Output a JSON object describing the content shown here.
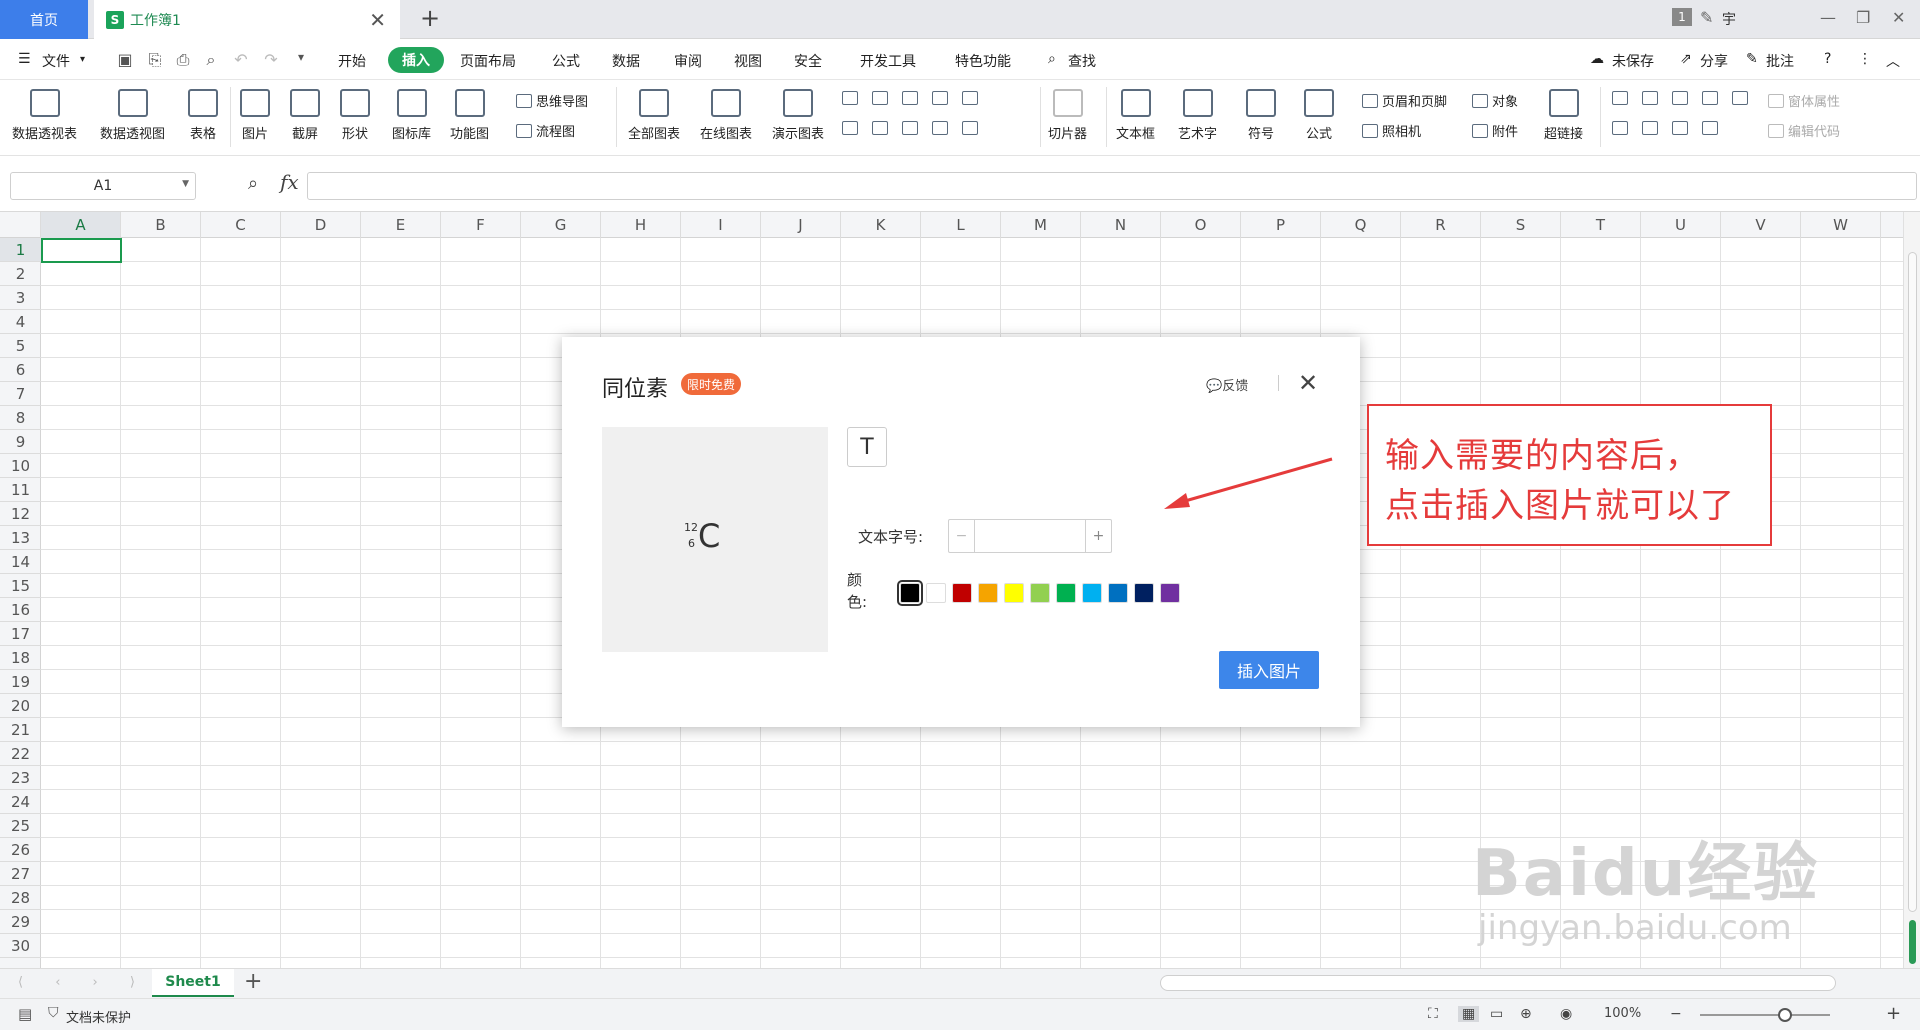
{
  "tabs": {
    "home": "首页",
    "doc": "工作簿1",
    "doc_icon": "S",
    "new": "+",
    "close": "✕"
  },
  "window": {
    "badge": "1",
    "user": "宇"
  },
  "menu": {
    "file": "文件",
    "items": [
      "开始",
      "插入",
      "页面布局",
      "公式",
      "数据",
      "审阅",
      "视图",
      "安全",
      "开发工具",
      "特色功能"
    ],
    "search": "查找",
    "active": "插入",
    "right": [
      "未保存",
      "分享",
      "批注"
    ]
  },
  "ribbon": {
    "big": [
      "数据透视表",
      "数据透视图",
      "表格",
      "图片",
      "截屏",
      "形状",
      "图标库",
      "功能图",
      "全部图表",
      "在线图表",
      "演示图表",
      "切片器",
      "文本框",
      "艺术字",
      "符号",
      "公式",
      "超链接"
    ],
    "small": [
      "思维导图",
      "流程图",
      "页眉和页脚",
      "照相机",
      "对象",
      "附件",
      "窗体属性",
      "编辑代码"
    ]
  },
  "formula": {
    "cell": "A1",
    "fx": "fx"
  },
  "grid": {
    "columns": [
      "A",
      "B",
      "C",
      "D",
      "E",
      "F",
      "G",
      "H",
      "I",
      "J",
      "K",
      "L",
      "M",
      "N",
      "O",
      "P",
      "Q",
      "R",
      "S",
      "T",
      "U",
      "V",
      "W"
    ],
    "rows": [
      "1",
      "2",
      "3",
      "4",
      "5",
      "6",
      "7",
      "8",
      "9",
      "10",
      "11",
      "12",
      "13",
      "14",
      "15",
      "16",
      "17",
      "18",
      "19",
      "20",
      "21",
      "22",
      "23",
      "24",
      "25",
      "26",
      "27",
      "28",
      "29",
      "30"
    ]
  },
  "sheet": {
    "name": "Sheet1"
  },
  "status": {
    "protect": "文档未保护",
    "zoom": "100%"
  },
  "dialog": {
    "title": "同位素",
    "badge": "限时免费",
    "feedback": "反馈",
    "preview": {
      "mass": "12",
      "atomic": "6",
      "element": "C"
    },
    "t_button": "T",
    "size_label": "文本字号:",
    "color_label": "颜色:",
    "colors": [
      "#000000",
      "#ffffff",
      "#c00000",
      "#f5a400",
      "#ffff00",
      "#92d050",
      "#00b050",
      "#00b0f0",
      "#0070c0",
      "#002060",
      "#7030a0"
    ],
    "insert": "插入图片"
  },
  "annotation": {
    "line1": "输入需要的内容后，",
    "line2": "点击插入图片就可以了"
  },
  "watermark": {
    "big": "Baidu经验",
    "small": "jingyan.baidu.com"
  }
}
